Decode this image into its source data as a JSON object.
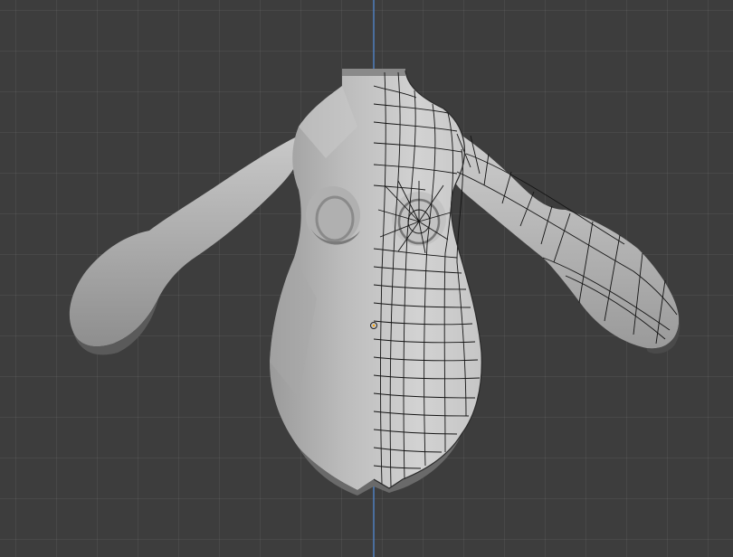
{
  "viewport": {
    "background_color": "#3d3d3d",
    "grid_line_color": "#4a4a4a",
    "axis_line_color": "#4f7fbf"
  },
  "mesh": {
    "display_left": "solid",
    "display_right": "wireframe-overlay",
    "solid_color": "#b8b8b8",
    "wire_color": "#141414"
  },
  "origin": {
    "icon": "object-origin-icon"
  }
}
